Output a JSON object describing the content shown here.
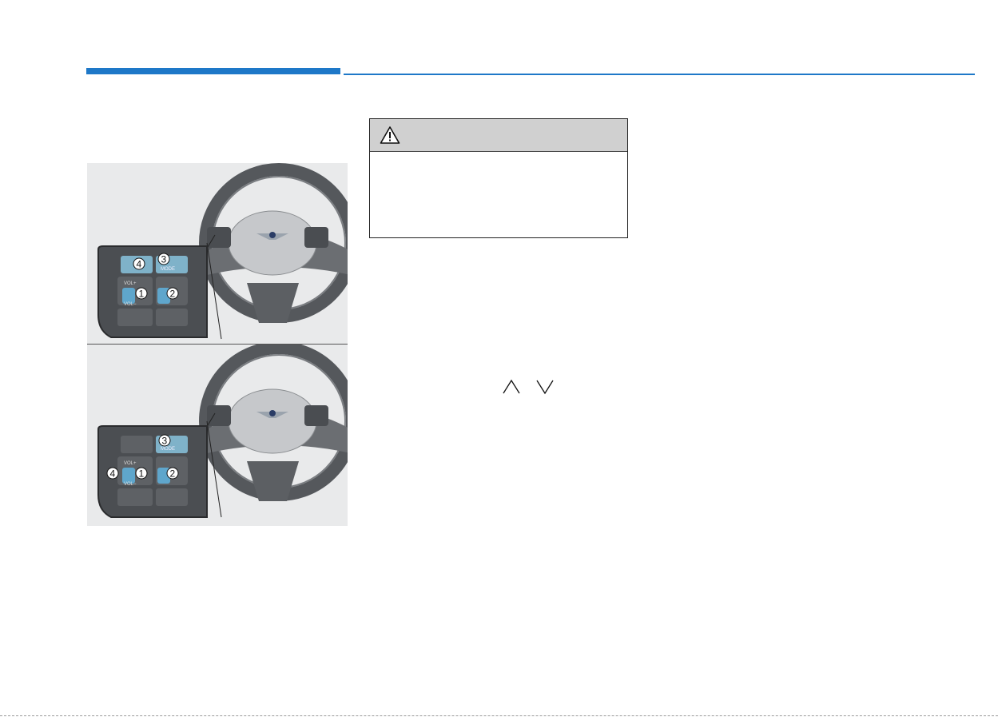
{
  "page": {
    "header_colors": {
      "accent": "#1e78c8"
    }
  },
  "caution_box": {
    "icon": "warning-triangle-icon",
    "title": ""
  },
  "figure_top": {
    "callouts": [
      {
        "num": "1"
      },
      {
        "num": "2"
      },
      {
        "num": "3"
      },
      {
        "num": "4"
      }
    ],
    "button_labels": {
      "vol_plus": "VOL+",
      "vol_minus": "VOL−",
      "mode": "MODE"
    }
  },
  "figure_bottom": {
    "callouts": [
      {
        "num": "1"
      },
      {
        "num": "2"
      },
      {
        "num": "3"
      },
      {
        "num": "4"
      }
    ],
    "button_labels": {
      "vol_plus": "VOL+",
      "vol_minus": "VOL−",
      "mode": "MODE"
    }
  },
  "arrows": {
    "up": "up-chevron-icon",
    "down": "down-chevron-icon"
  }
}
